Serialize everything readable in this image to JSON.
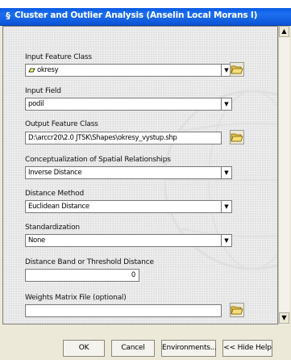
{
  "window": {
    "title": "Cluster and Outlier Analysis (Anselin Local Morans I)"
  },
  "fields": {
    "input_feature_class": {
      "label": "Input Feature Class",
      "value": "okresy"
    },
    "input_field": {
      "label": "Input Field",
      "value": "podil"
    },
    "output_feature_class": {
      "label": "Output Feature Class",
      "value": "D:\\arccr20\\2.0 JTSK\\Shapes\\okresy_vystup.shp"
    },
    "conceptualization": {
      "label": "Conceptualization of Spatial Relationships",
      "value": "Inverse Distance"
    },
    "distance_method": {
      "label": "Distance Method",
      "value": "Euclidean Distance"
    },
    "standardization": {
      "label": "Standardization",
      "value": "None"
    },
    "distance_band": {
      "label": "Distance Band or Threshold Distance",
      "value": "0"
    },
    "weights_matrix": {
      "label": "Weights Matrix File (optional)",
      "value": ""
    }
  },
  "buttons": {
    "ok": "OK",
    "cancel": "Cancel",
    "environments": "Environments...",
    "hide_help": "<< Hide Help"
  },
  "icons": {
    "title": "toolbox-icon",
    "folder": "open-folder-icon",
    "dropdown": "chevron-down-icon",
    "polygon": "polygon-layer-icon"
  }
}
